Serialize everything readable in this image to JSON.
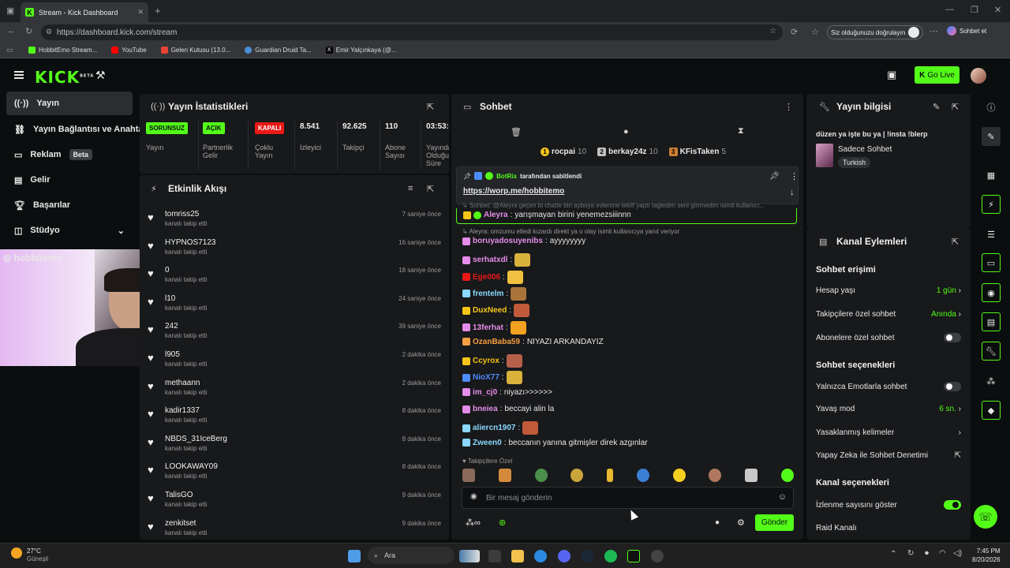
{
  "browser": {
    "tab_title": "Stream - Kick Dashboard",
    "url": "https://dashboard.kick.com/stream",
    "status_pill": "Siz olduğunuzu doğrulayın",
    "copilot_label": "Sohbet et",
    "bookmarks": [
      "HobbitEmo Stream...",
      "YouTube",
      "Gelen Kutusu (13.0...",
      "Guardian Druid Ta...",
      "Emir Yalçınkaya (@..."
    ]
  },
  "header": {
    "logo": "KICK",
    "logo_sup": "BETA",
    "go_live": "Go Live"
  },
  "nav": {
    "items": [
      {
        "label": "Yayın"
      },
      {
        "label": "Yayın Bağlantısı ve Anahtar"
      },
      {
        "label": "Reklam",
        "badge": "Beta"
      },
      {
        "label": "Gelir"
      },
      {
        "label": "Başarılar"
      },
      {
        "label": "Stüdyo"
      }
    ]
  },
  "webcam": {
    "handle": "hobbitemo"
  },
  "stats": {
    "title": "Yayın İstatistikleri",
    "items": [
      {
        "value": "SORUNSUZ",
        "label": "Yayın",
        "color": "#53fc18"
      },
      {
        "value": "AÇIK",
        "label": "Partnerlik Gelir",
        "color": "#53fc18"
      },
      {
        "value": "KAPALI",
        "label": "Çoklu Yayın",
        "color": "#e91916"
      },
      {
        "value": "8.541",
        "label": "İzleyici"
      },
      {
        "value": "92.625",
        "label": "Takipçi"
      },
      {
        "value": "110",
        "label": "Abone Sayısı"
      },
      {
        "value": "03:53:",
        "label": "Yayında Olduğu Süre"
      }
    ]
  },
  "activity": {
    "title": "Etkinlik Akışı",
    "items": [
      {
        "name": "tomriss25",
        "sub": "kanalı takip etti",
        "time": "7 saniye önce"
      },
      {
        "name": "HYPNOS7123",
        "sub": "kanalı takip etti",
        "time": "16 saniye önce"
      },
      {
        "name": "0",
        "sub": "kanalı takip etti",
        "time": "18 saniye önce"
      },
      {
        "name": "l10",
        "sub": "kanalı takip etti",
        "time": "24 saniye önce"
      },
      {
        "name": "242",
        "sub": "kanalı takip etti",
        "time": "39 saniye önce"
      },
      {
        "name": "l905",
        "sub": "kanalı takip etti",
        "time": "2 dakika önce"
      },
      {
        "name": "methaann",
        "sub": "kanalı takip etti",
        "time": "2 dakika önce"
      },
      {
        "name": "kadir1337",
        "sub": "kanalı takip etti",
        "time": "8 dakika önce"
      },
      {
        "name": "NBDS_31IceBerg",
        "sub": "kanalı takip etti",
        "time": "8 dakika önce"
      },
      {
        "name": "LOOKAWAY09",
        "sub": "kanalı takip etti",
        "time": "8 dakika önce"
      },
      {
        "name": "TalisGO",
        "sub": "kanalı takip etti",
        "time": "9 dakika önce"
      },
      {
        "name": "zenkitset",
        "sub": "kanalı takip etti",
        "time": "9 dakika önce"
      }
    ]
  },
  "chat": {
    "title": "Sohbet",
    "leaders": [
      {
        "rank": "1",
        "name": "rocpai",
        "score": "10",
        "color": "#f5c518"
      },
      {
        "rank": "2",
        "name": "berkay24z",
        "score": "10",
        "color": "#c0c0c0"
      },
      {
        "rank": "3",
        "name": "KFisTaken",
        "score": "5",
        "color": "#cd7f32"
      }
    ],
    "pinned": {
      "by": "BotRix",
      "by_suffix": "tarafından sabitlendi",
      "link": "https://worp.me/hobbitemo"
    },
    "reply_hidden": "Sohbet: @Aleyra geçen bi chatte biri ayboya evlenme teklif yaptı tagledim seni görmedim isimli kullanıcı...",
    "pinned_line": {
      "user": "Aleyra",
      "text": "yarışmayan birini yenemezsiiinnn"
    },
    "reply_hint": "Aleyra: omzumu elledi kızardı direkt ya o olay isimli kullanıcıya yanıt veriyor",
    "messages": [
      {
        "user": "boruyadosuyenibs",
        "text": "ayyyyyyyy",
        "color": "#e48ce8",
        "emote": false
      },
      {
        "user": "serhatxdl",
        "text": "",
        "color": "#e48ce8",
        "emote": true
      },
      {
        "user": "Ege006",
        "text": "",
        "color": "#e91916",
        "emote": true
      },
      {
        "user": "frentelm",
        "text": "",
        "color": "#8ad8ff",
        "emote": true
      },
      {
        "user": "DuxNeed",
        "text": "",
        "color": "#f5c518",
        "emote": true
      },
      {
        "user": "13ferhat",
        "text": "",
        "color": "#e48ce8",
        "emote": true
      },
      {
        "user": "OzanBaba59",
        "text": "NIYAZI ARKANDAYIZ",
        "color": "#f59e42",
        "emote": false
      },
      {
        "user": "Ccyrox",
        "text": "",
        "color": "#f5c518",
        "emote": true
      },
      {
        "user": "NioX77",
        "text": "",
        "color": "#4f8cff",
        "emote": true
      },
      {
        "user": "im_cj0",
        "text": "niyazı>>>>>>",
        "color": "#e48ce8",
        "emote": false
      },
      {
        "user": "bneiea",
        "text": "beccayi alin la",
        "color": "#e48ce8",
        "emote": false
      },
      {
        "user": "aliercn1907",
        "text": "",
        "color": "#8ad8ff",
        "emote": true
      },
      {
        "user": "Zween0",
        "text": "beccanın yanına gitmişler direk azgınlar",
        "color": "#8ad8ff",
        "emote": false
      }
    ],
    "emote_section": "Takipçilere Özel",
    "input_placeholder": "Bir mesaj gönderin",
    "send": "Gönder"
  },
  "stream_info": {
    "title": "Yayın bilgisi",
    "stream_title": "düzen ya işte bu ya | !insta !blerp",
    "category": "Sadece Sohbet",
    "tag": "Turkish"
  },
  "channel_actions": {
    "title": "Kanal Eylemleri",
    "chat_access": "Sohbet erişimi",
    "account_age": {
      "label": "Hesap yaşı",
      "value": "1 gün"
    },
    "followers_only": {
      "label": "Takipçilere özel sohbet",
      "value": "Anında"
    },
    "subs_only": {
      "label": "Abonelere özel sohbet",
      "on": false
    },
    "chat_options": "Sohbet seçenekleri",
    "emote_only": {
      "label": "Yalnızca Emotlarla sohbet",
      "on": false
    },
    "slow_mode": {
      "label": "Yavaş mod",
      "value": "6 sn."
    },
    "banned_words": {
      "label": "Yasaklanmış kelimeler"
    },
    "ai_mod": {
      "label": "Yapay Zeka ile Sohbet Denetimi"
    },
    "channel_options": "Kanal seçenekleri",
    "show_views": {
      "label": "İzlenme sayısını göster",
      "on": true
    },
    "raid": {
      "label": "Raid Kanalı"
    }
  },
  "taskbar": {
    "weather_temp": "27°C",
    "weather_desc": "Güneşli",
    "search": "Ara",
    "time": "7:45 PM",
    "date": "8/20/2026"
  },
  "colors": {
    "accent": "#53fc18",
    "panel": "#18191b",
    "bg": "#0b0e0f"
  }
}
